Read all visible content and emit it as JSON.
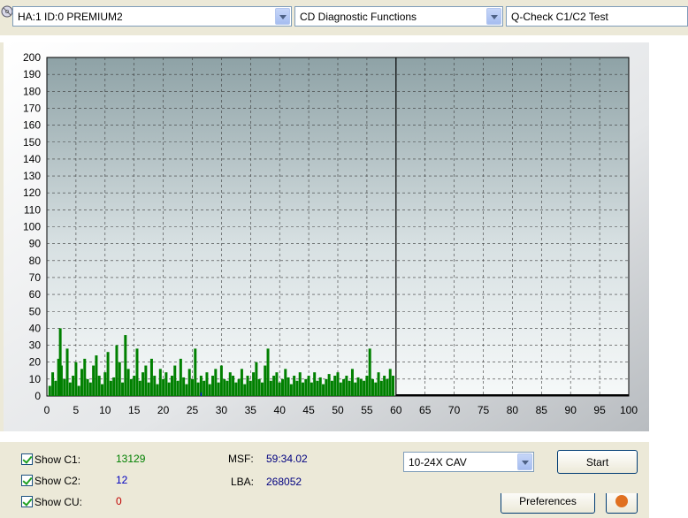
{
  "toolbar": {
    "device": "HA:1 ID:0  PREMIUM2",
    "function": "CD Diagnostic Functions",
    "test": "Q-Check C1/C2 Test"
  },
  "chart_data": {
    "type": "bar",
    "xlim": [
      0,
      100
    ],
    "ylim": [
      0,
      200
    ],
    "x_ticks": [
      "0",
      "5",
      "10",
      "15",
      "20",
      "25",
      "30",
      "35",
      "40",
      "45",
      "50",
      "55",
      "60",
      "65",
      "70",
      "75",
      "80",
      "85",
      "90",
      "95",
      "100"
    ],
    "y_ticks": [
      "200",
      "190",
      "180",
      "170",
      "160",
      "150",
      "140",
      "130",
      "120",
      "110",
      "100",
      "90",
      "80",
      "70",
      "60",
      "50",
      "40",
      "30",
      "20",
      "10",
      "0"
    ],
    "grid": true,
    "end_marker_x": 60,
    "series": [
      {
        "color": "#008000",
        "x": [
          0.5,
          1,
          1.5,
          2,
          2.3,
          2.5,
          3,
          3.5,
          4,
          4.5,
          5,
          5.5,
          6,
          6.5,
          7,
          7.5,
          8,
          8.5,
          9,
          9.5,
          10,
          10.5,
          11,
          11.5,
          12,
          12.5,
          13,
          13.5,
          14,
          14.5,
          15,
          15.5,
          16,
          16.5,
          17,
          17.5,
          18,
          18.5,
          19,
          19.5,
          20,
          20.5,
          21,
          21.5,
          22,
          22.5,
          23,
          23.5,
          24,
          24.5,
          25,
          25.5,
          26,
          26.5,
          27,
          27.5,
          28,
          28.5,
          29,
          29.5,
          30,
          30.5,
          31,
          31.5,
          32,
          32.5,
          33,
          33.5,
          34,
          34.5,
          35,
          35.5,
          36,
          36.5,
          37,
          37.5,
          38,
          38.5,
          39,
          39.5,
          40,
          40.5,
          41,
          41.5,
          42,
          42.5,
          43,
          43.5,
          44,
          44.5,
          45,
          45.5,
          46,
          46.5,
          47,
          47.5,
          48,
          48.5,
          49,
          49.5,
          50,
          50.5,
          51,
          51.5,
          52,
          52.5,
          53,
          53.5,
          54,
          54.5,
          55,
          55.5,
          56,
          56.5,
          57,
          57.5,
          58,
          58.5,
          59,
          59.5
        ],
        "values": [
          6,
          14,
          9,
          22,
          40,
          18,
          10,
          28,
          8,
          12,
          20,
          6,
          16,
          22,
          10,
          8,
          18,
          24,
          12,
          7,
          14,
          26,
          9,
          11,
          30,
          20,
          8,
          36,
          16,
          10,
          12,
          28,
          9,
          14,
          18,
          8,
          22,
          12,
          7,
          16,
          10,
          14,
          8,
          12,
          18,
          9,
          22,
          11,
          7,
          16,
          10,
          28,
          8,
          12,
          9,
          14,
          7,
          12,
          16,
          8,
          18,
          10,
          9,
          14,
          12,
          8,
          10,
          16,
          7,
          12,
          9,
          14,
          20,
          10,
          8,
          18,
          28,
          9,
          12,
          14,
          8,
          10,
          16,
          11,
          7,
          12,
          9,
          14,
          8,
          10,
          12,
          8,
          14,
          9,
          11,
          7,
          10,
          13,
          9,
          12,
          14,
          8,
          10,
          12,
          9,
          16,
          8,
          11,
          10,
          9,
          12,
          28,
          10,
          8,
          14,
          9,
          12,
          10,
          16,
          12
        ]
      },
      {
        "color": "#0000ff",
        "x": [
          26.5
        ],
        "values": [
          2
        ]
      }
    ]
  },
  "controls": {
    "show_c1_label": "Show C1:",
    "show_c1_value": "13129",
    "show_c2_label": "Show C2:",
    "show_c2_value": "12",
    "show_cu_label": "Show CU:",
    "show_cu_value": "0",
    "msf_label": "MSF:",
    "msf_value": "59:34.02",
    "lba_label": "LBA:",
    "lba_value": "268052",
    "speed": "10-24X CAV",
    "start": "Start",
    "preferences": "Preferences",
    "colors": {
      "c1": "#008000",
      "c2": "#0000c0",
      "cu": "#c00000",
      "info": "#000080"
    }
  }
}
